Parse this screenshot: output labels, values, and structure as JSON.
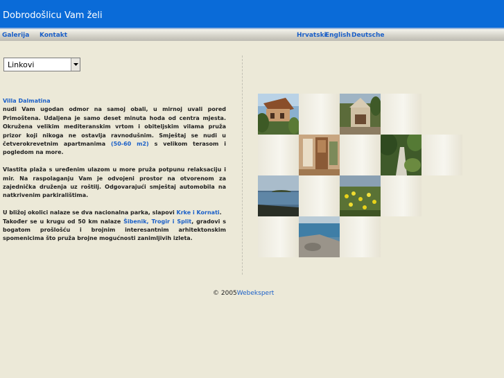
{
  "header": {
    "title": "Dobrodošlicu Vam želi"
  },
  "nav": {
    "galerija": "Galerija",
    "kontakt": "Kontakt",
    "hrvatski": "Hrvatski",
    "english": "English",
    "deutsche": "Deutsche"
  },
  "dropdown": {
    "selected": "Linkovi"
  },
  "content": {
    "villa_title": "Villa Dalmatina",
    "p1_text": "nudi Vam ugodan odmor na samoj obali, u mirnoj uvali pored Primoštena. Udaljena je samo deset minuta hoda od centra mjesta. Okružena velikim mediteranskim vrtom i obiteljskim vilama pruža prizor koji nikoga ne ostavlja ravnodušnim. Smještaj se nudi u četverokrevetnim apartmanima ",
    "p1_link": "(50-60 m2)",
    "p1_tail": " s velikom terasom i pogledom na more.",
    "p2": "Vlastita plaža s uređenim ulazom u more pruža potpunu relaksaciju i mir. Na raspolaganju Vam je odvojeni prostor na otvorenom za zajednička druženja uz roštilj. Odgovarajući smještaj automobila na natkrivenim parkiralištima.",
    "p3_a": "U bližoj okolici nalaze se dva nacionalna parka, slapovi ",
    "p3_link1": "Krke i Kornati",
    "p3_b": ".",
    "p3_c": "Također se u krugu od 50 km nalaze ",
    "p3_link2": "Šibenik, Trogir i Split",
    "p3_d": ", gradovi s bogatom prošlošću i brojnim interesantnim arhitektonskim spomenicima što pruža brojne mogućnosti zanimljivih izleta."
  },
  "footer": {
    "copyright": "© 2005",
    "link": "Webekspert"
  },
  "colors": {
    "banner": "#0a6bd8",
    "link": "#1a5fc8",
    "background": "#ece9d8"
  }
}
